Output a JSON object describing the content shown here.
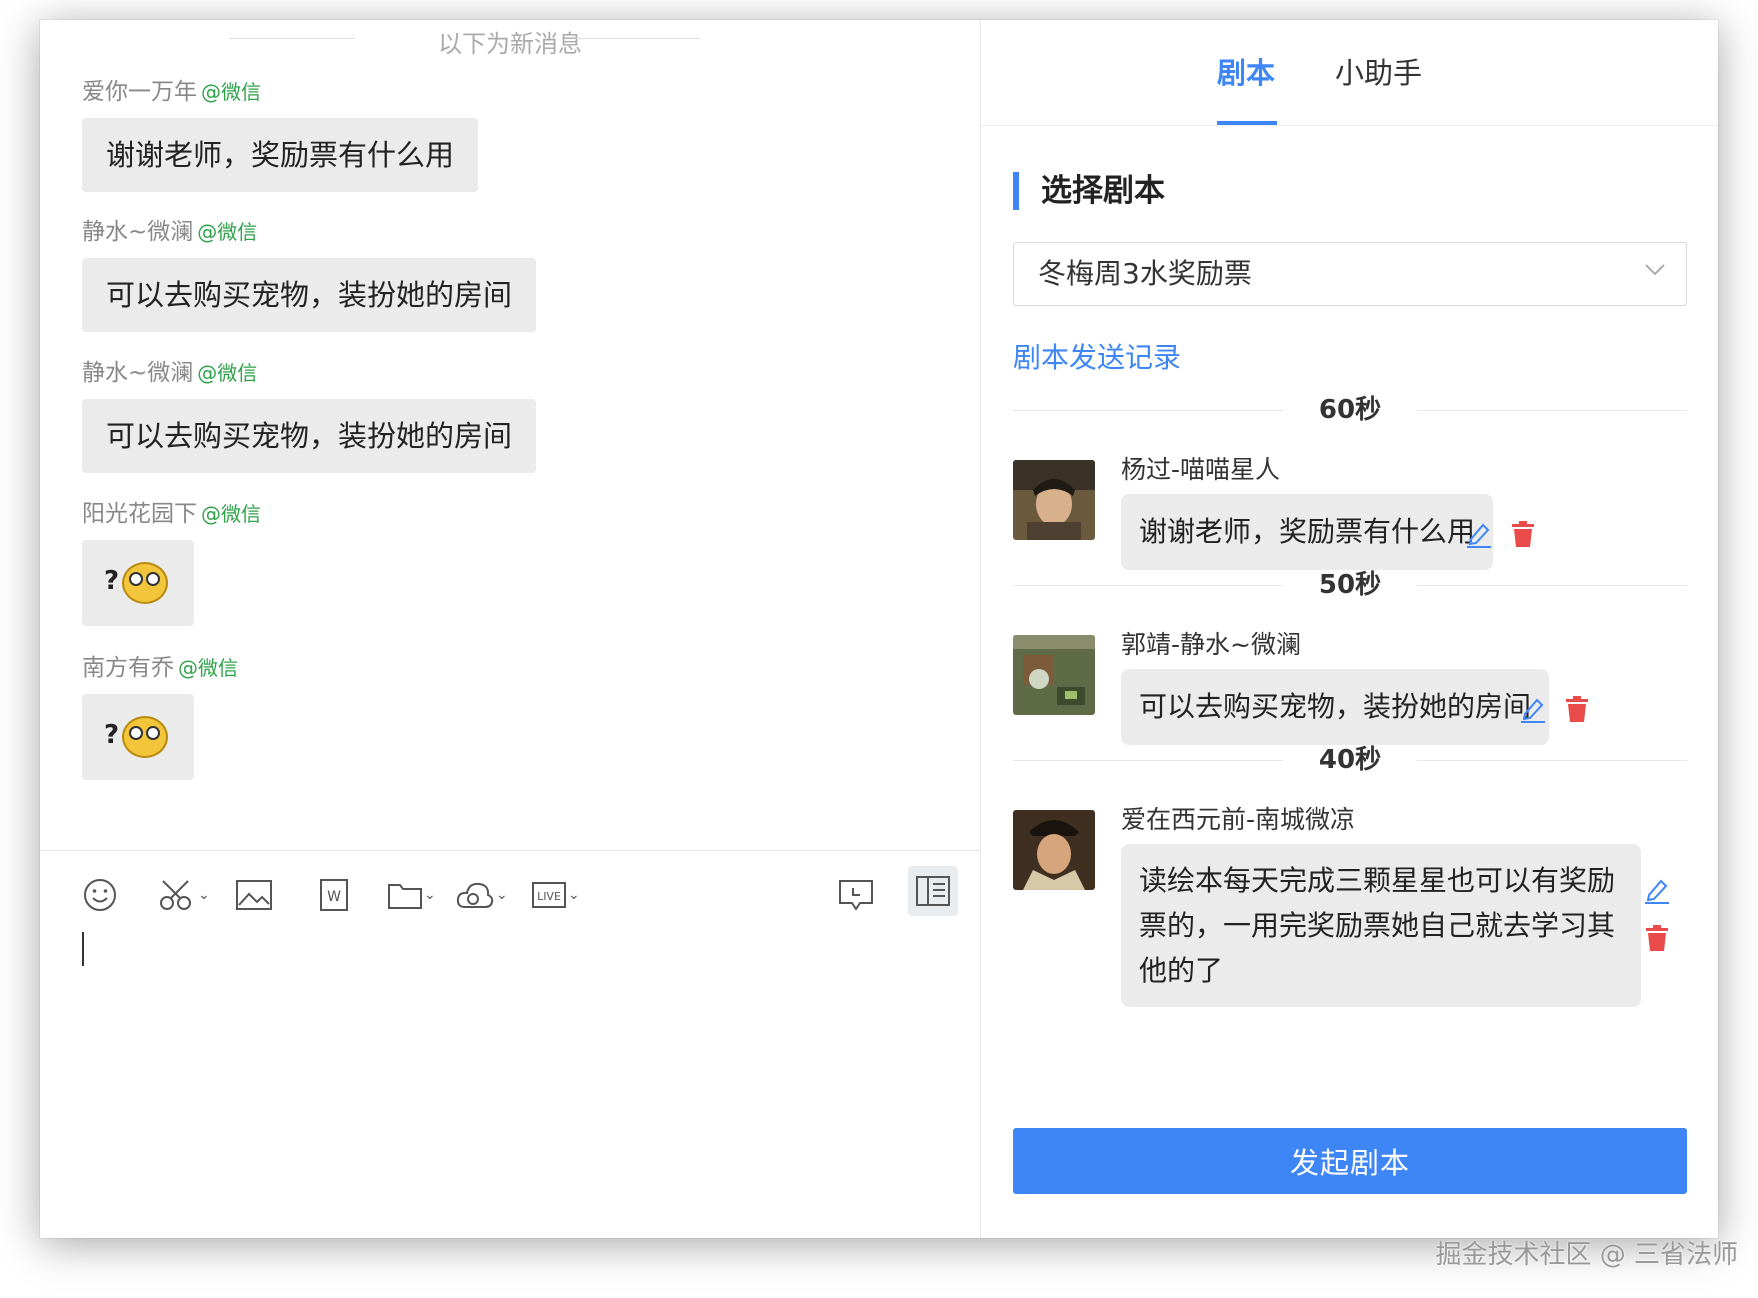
{
  "chat": {
    "new_messages_divider": "以下为新消息",
    "messages": [
      {
        "sender": "爱你一万年",
        "source": "@微信",
        "text": "谢谢老师，奖励票有什么用"
      },
      {
        "sender": "静水~微澜",
        "source": "@微信",
        "text": "可以去购买宠物，装扮她的房间"
      },
      {
        "sender": "静水~微澜",
        "source": "@微信",
        "text": "可以去购买宠物，装扮她的房间"
      },
      {
        "sender": "阳光花园下",
        "source": "@微信",
        "text": "?"
      },
      {
        "sender": "南方有乔",
        "source": "@微信",
        "text": "?"
      }
    ],
    "toolbar_icons": [
      "emoji-icon",
      "scissors-icon",
      "image-icon",
      "word-doc-icon",
      "folder-icon",
      "cloud-icon",
      "live-icon",
      "comment-icon",
      "sidebar-toggle-icon"
    ],
    "live_label": "LIVE",
    "word_label": "W"
  },
  "panel": {
    "tabs": [
      {
        "label": "剧本",
        "active": true
      },
      {
        "label": "小助手",
        "active": false
      }
    ],
    "section_title": "选择剧本",
    "script_select": {
      "selected": "冬梅周3水奖励票"
    },
    "send_record_link": "剧本发送记录",
    "script_items": [
      {
        "delay": "60秒",
        "name": "杨过-喵喵星人",
        "text": "谢谢老师，奖励票有什么用"
      },
      {
        "delay": "50秒",
        "name": "郭靖-静水~微澜",
        "text": "可以去购买宠物，装扮她的房间"
      },
      {
        "delay": "40秒",
        "name": "爱在西元前-南城微凉",
        "text": "读绘本每天完成三颗星星也可以有奖励票的，一用完奖励票她自己就去学习其他的了"
      }
    ],
    "start_button": "发起剧本",
    "accent_color": "#3e86f5",
    "delete_color": "#e94b4b"
  },
  "watermark": "掘金技术社区 @ 三省法师"
}
